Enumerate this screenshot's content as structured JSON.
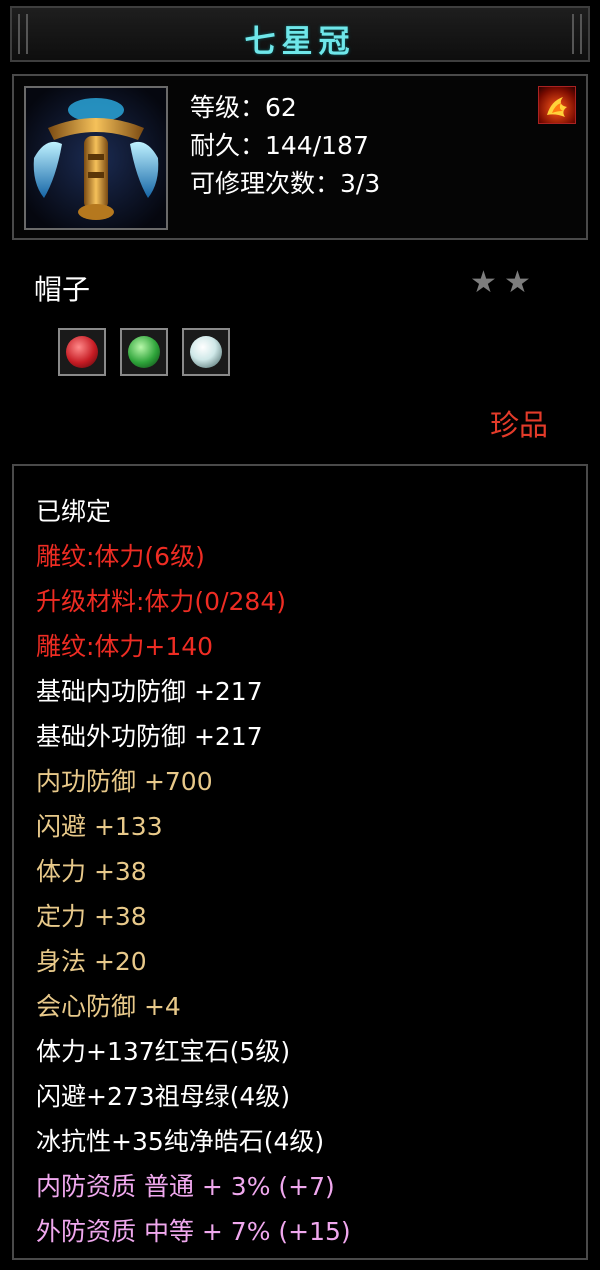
{
  "title": "七星冠",
  "icons": {
    "item": "helmet-crown-icon",
    "element": "fire-element-icon",
    "star": "star-icon"
  },
  "stats": {
    "level": "等级：62",
    "durability": "耐久：144/187",
    "repairs": "可修理次数：3/3"
  },
  "item_type": "帽子",
  "stars_count": 2,
  "gems": [
    {
      "name": "ruby-gem-icon",
      "color": "#c61c24"
    },
    {
      "name": "emerald-gem-icon",
      "color": "#2ea43a"
    },
    {
      "name": "diamond-gem-icon",
      "color": "#cfe8e8"
    }
  ],
  "quality": "珍品",
  "attributes": [
    {
      "text": "已绑定",
      "color": "white"
    },
    {
      "text": "雕纹:体力(6级)",
      "color": "red"
    },
    {
      "text": "升级材料:体力(0/284)",
      "color": "red"
    },
    {
      "text": "雕纹:体力+140",
      "color": "red"
    },
    {
      "text": "基础内功防御 +217",
      "color": "white"
    },
    {
      "text": "基础外功防御 +217",
      "color": "white"
    },
    {
      "text": "内功防御 +700",
      "color": "gold"
    },
    {
      "text": "闪避 +133",
      "color": "gold"
    },
    {
      "text": "体力 +38",
      "color": "gold"
    },
    {
      "text": "定力 +38",
      "color": "gold"
    },
    {
      "text": "身法 +20",
      "color": "gold"
    },
    {
      "text": "会心防御 +4",
      "color": "gold"
    },
    {
      "text": "体力+137红宝石(5级)",
      "color": "white"
    },
    {
      "text": "闪避+273祖母绿(4级)",
      "color": "white"
    },
    {
      "text": "冰抗性+35纯净皓石(4级)",
      "color": "white"
    },
    {
      "text": "内防资质 普通 + 3% (+7)",
      "color": "pink"
    },
    {
      "text": "外防资质 中等 + 7% (+15)",
      "color": "pink"
    }
  ],
  "colors": {
    "title": "#6fe7ea",
    "red": "#ee2c23",
    "gold": "#e8c98a",
    "pink": "#f0a8ee",
    "white": "#ffffff"
  }
}
